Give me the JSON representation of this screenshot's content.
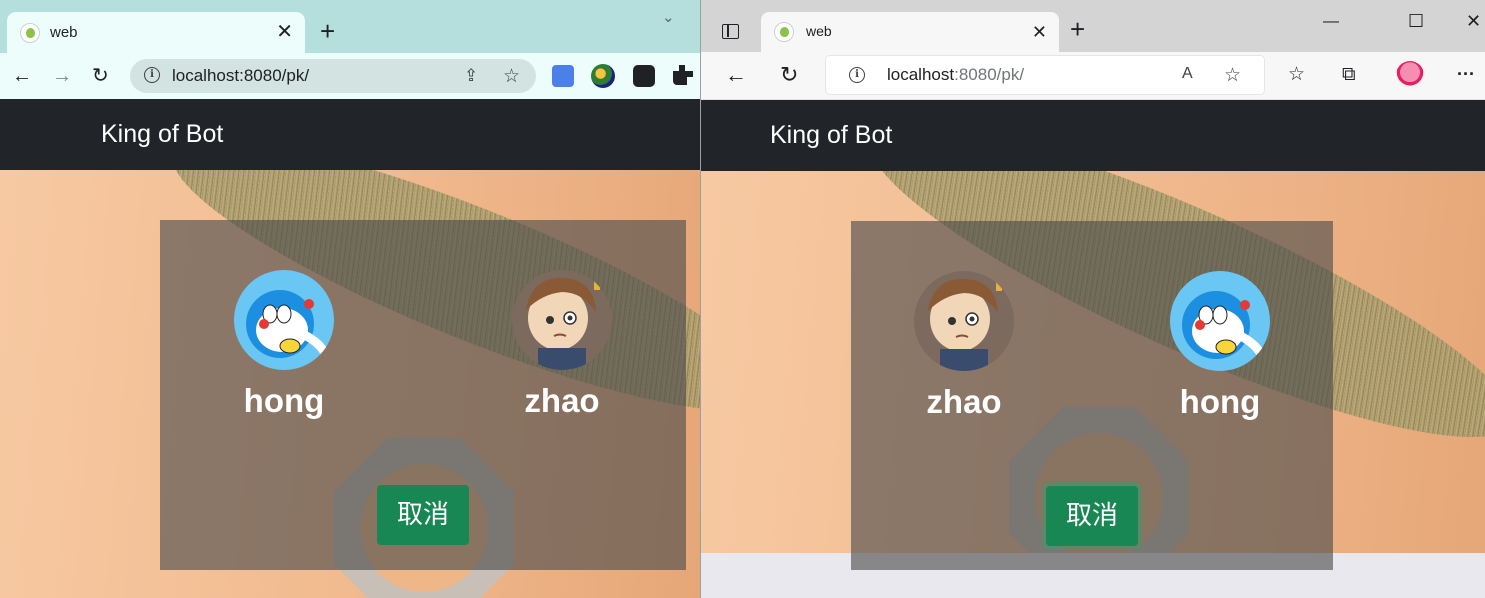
{
  "windows": {
    "chrome": {
      "tab": {
        "title": "web",
        "close": "✕"
      },
      "new_tab": "+",
      "tab_list": "⌄",
      "toolbar": {
        "back": "←",
        "forward": "→",
        "reload": "↻",
        "share": "⇪",
        "bookmark": "☆",
        "info": "i"
      },
      "address": {
        "host": "localhost",
        "rest": ":8080/pk/"
      }
    },
    "edge": {
      "tab": {
        "title": "web",
        "close": "✕"
      },
      "new_tab": "+",
      "window_controls": {
        "minimize": "—",
        "maximize": "☐",
        "close": "✕"
      },
      "toolbar": {
        "back": "←",
        "reload": "↻",
        "read_aloud": "A",
        "add_favorite": "☆",
        "favorites": "☆",
        "collections": "⧉",
        "more": "···",
        "info": "i"
      },
      "address": {
        "host": "localhost",
        "rest": ":8080/pk/"
      }
    }
  },
  "page": {
    "brand": "King of Bot",
    "left_view": {
      "players": [
        {
          "name": "hong",
          "avatar": "doraemon-avatar"
        },
        {
          "name": "zhao",
          "avatar": "boy-avatar"
        }
      ],
      "cancel_label": "取消"
    },
    "right_view": {
      "players": [
        {
          "name": "zhao",
          "avatar": "boy-avatar"
        },
        {
          "name": "hong",
          "avatar": "doraemon-avatar"
        }
      ],
      "cancel_label": "取消"
    }
  },
  "colors": {
    "navbar": "#212529",
    "cancel_button": "#198754",
    "chrome_tabstrip": "#b4dfdc",
    "edge_tabstrip": "#d4d4d4"
  }
}
